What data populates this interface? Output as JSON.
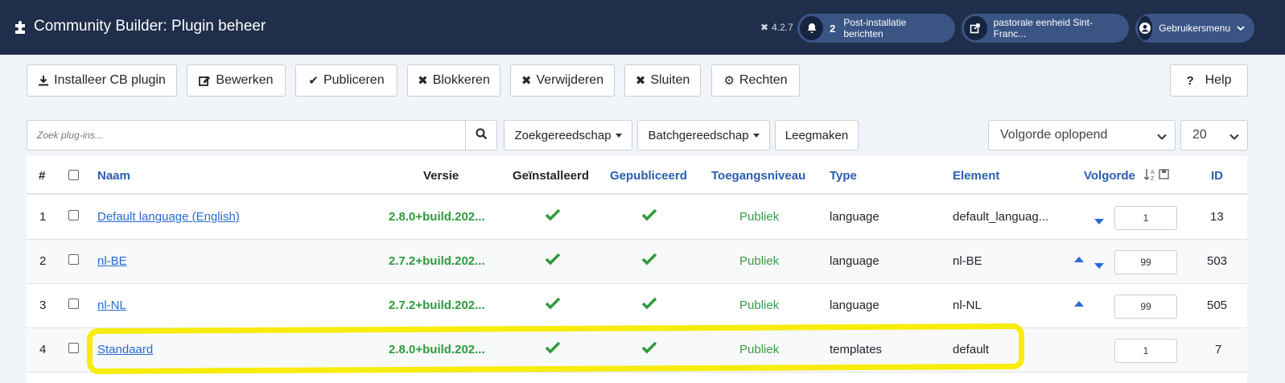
{
  "header": {
    "title": "Community Builder: Plugin beheer",
    "version": "4.2.7",
    "notifications_count": "2",
    "notifications_label": "Post-installatie berichten",
    "site_label": "pastorale eenheid Sint-Franc...",
    "user_menu_label": "Gebruikersmenu"
  },
  "toolbar": {
    "install": "Installeer CB plugin",
    "edit": "Bewerken",
    "publish": "Publiceren",
    "block": "Blokkeren",
    "delete": "Verwijderen",
    "close": "Sluiten",
    "rights": "Rechten",
    "help": "Help"
  },
  "filters": {
    "search_placeholder": "Zoek plug-ins...",
    "search_tools": "Zoekgereedschap",
    "batch_tools": "Batchgereedschap",
    "clear": "Leegmaken",
    "ordering": "Volgorde oplopend",
    "limit": "20"
  },
  "table": {
    "headers": {
      "num": "#",
      "name": "Naam",
      "version": "Versie",
      "installed": "Geïnstalleerd",
      "published": "Gepubliceerd",
      "access": "Toegangsniveau",
      "type": "Type",
      "element": "Element",
      "ordering": "Volgorde",
      "id": "ID"
    },
    "rows": [
      {
        "num": "1",
        "name": "Default language (English)",
        "version": "2.8.0+build.202...",
        "access": "Publiek",
        "type": "language",
        "element": "default_languag...",
        "order": "1",
        "id": "13"
      },
      {
        "num": "2",
        "name": "nl-BE",
        "version": "2.7.2+build.202...",
        "access": "Publiek",
        "type": "language",
        "element": "nl-BE",
        "order": "99",
        "id": "503"
      },
      {
        "num": "3",
        "name": "nl-NL",
        "version": "2.7.2+build.202...",
        "access": "Publiek",
        "type": "language",
        "element": "nl-NL",
        "order": "99",
        "id": "505"
      },
      {
        "num": "4",
        "name": "Standaard",
        "version": "2.8.0+build.202...",
        "access": "Publiek",
        "type": "templates",
        "element": "default",
        "order": "1",
        "id": "7"
      }
    ]
  },
  "colors": {
    "header_bg": "#1f2e4a",
    "link": "#2a6ad0",
    "success": "#2e9a3c",
    "highlight": "#f7ec0a"
  }
}
